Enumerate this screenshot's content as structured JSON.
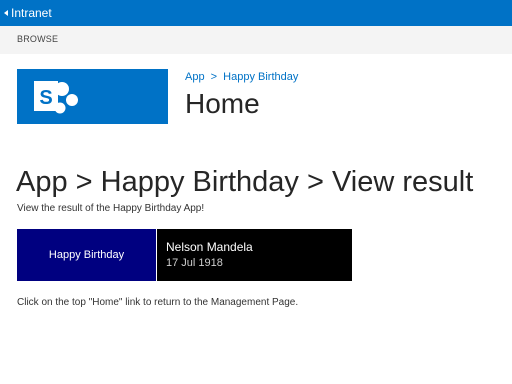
{
  "suite_bar": {
    "link_label": "Intranet",
    "color": "#0072c6"
  },
  "ribbon": {
    "tab_label": "BROWSE"
  },
  "site": {
    "logo_icon": "sharepoint-logo-icon",
    "breadcrumb": [
      "App",
      ">",
      "Happy Birthday"
    ],
    "title": "Home"
  },
  "main": {
    "heading": "App > Happy Birthday > View result",
    "subtitle": "View the result of the Happy Birthday App!",
    "result": {
      "greeting": "Happy Birthday",
      "name": "Nelson Mandela",
      "date": "17 Jul 1918",
      "greeting_bg": "#000080",
      "detail_bg": "#000000"
    },
    "note": "Click on the top \"Home\" link to return to the Management Page."
  }
}
